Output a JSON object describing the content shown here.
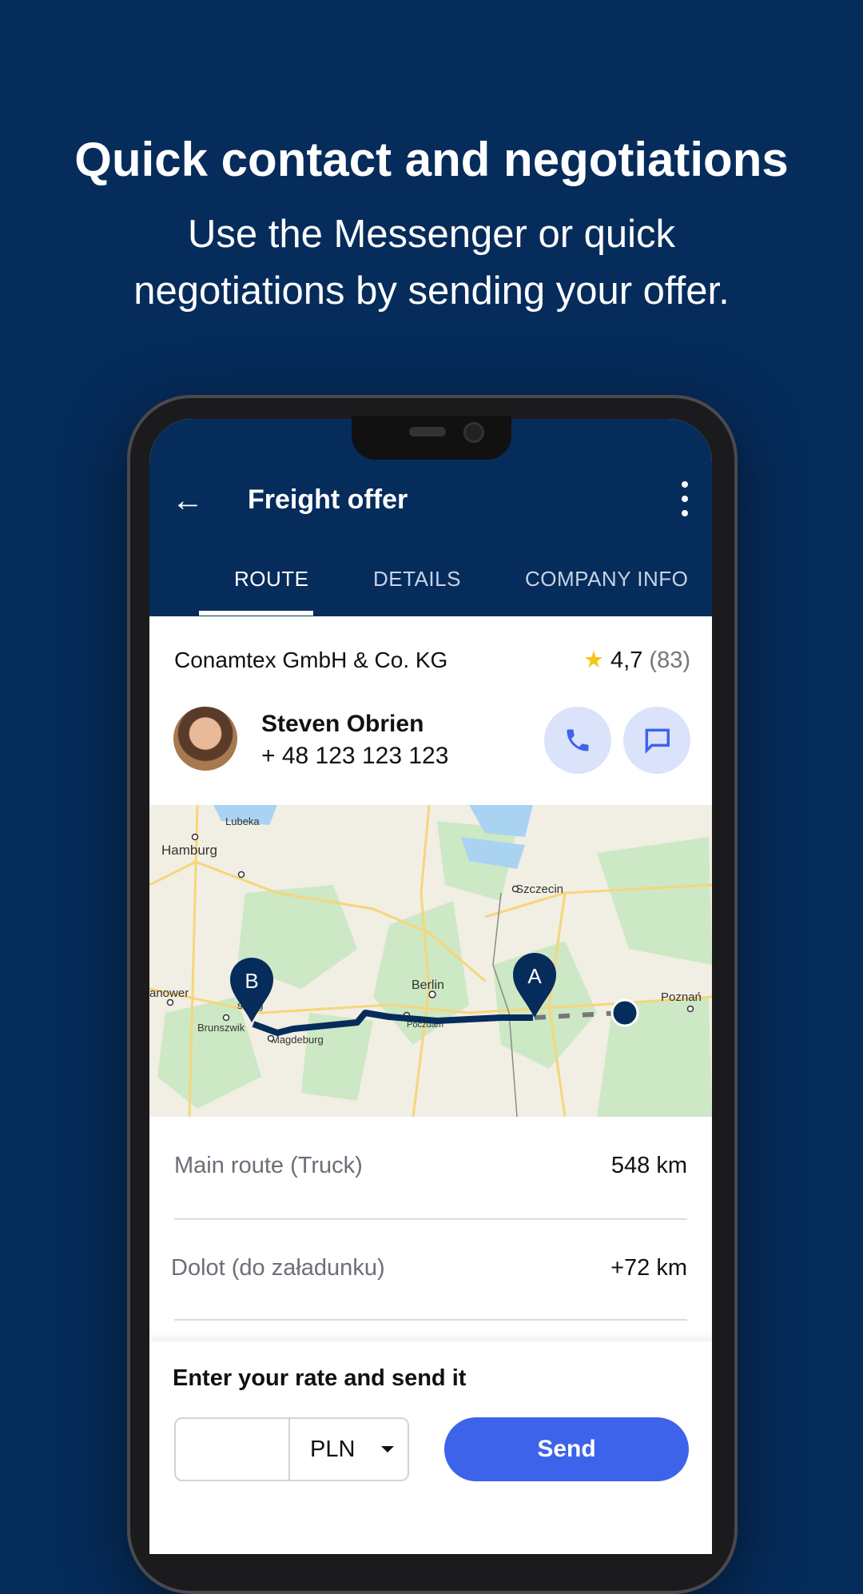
{
  "promo": {
    "headline": "Quick contact and negotiations",
    "subtitle_line1": "Use the Messenger or quick",
    "subtitle_line2": "negotiations by sending your offer."
  },
  "appbar": {
    "title": "Freight offer",
    "back_icon": "arrow-left-icon",
    "menu_icon": "more-vertical-icon"
  },
  "tabs": [
    {
      "label": "ROUTE",
      "active": true
    },
    {
      "label": "DETAILS",
      "active": false
    },
    {
      "label": "COMPANY INFO",
      "active": false
    }
  ],
  "company": {
    "name": "Conamtex GmbH & Co. KG",
    "rating": "4,7",
    "reviews": "(83)",
    "star_color": "#f5c518"
  },
  "contact": {
    "name": "Steven Obrien",
    "phone": "+ 48 123 123 123",
    "call_icon": "phone-icon",
    "message_icon": "chat-icon"
  },
  "map": {
    "labels": [
      "Lubeka",
      "Hamburg",
      "Szczecin",
      "anower",
      "sburg",
      "Brunszwik",
      "Magdeburg",
      "Berlin",
      "Poczdam",
      "Poznań"
    ],
    "marker_a": "A",
    "marker_b": "B",
    "route_color": "#062c5b"
  },
  "route": [
    {
      "label": "Main route (Truck)",
      "value": "548 km"
    },
    {
      "label": "Dolot (do załadunku)",
      "value": "+72 km"
    }
  ],
  "offer": {
    "label": "Enter your rate and send it",
    "rate_value": "",
    "currency": "PLN",
    "send_label": "Send"
  },
  "colors": {
    "background": "#062c5b",
    "accent": "#3d63ea"
  }
}
